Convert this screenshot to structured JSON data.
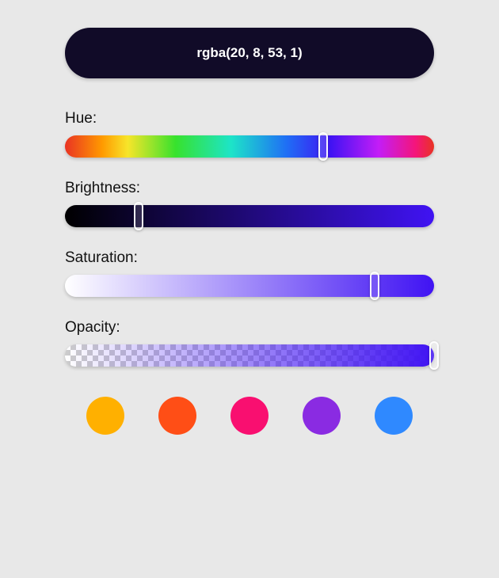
{
  "result": {
    "text": "rgba(20, 8, 53, 1)"
  },
  "sliders": {
    "hue": {
      "label": "Hue:",
      "value_pct": 70
    },
    "brightness": {
      "label": "Brightness:",
      "value_pct": 20
    },
    "saturation": {
      "label": "Saturation:",
      "value_pct": 84
    },
    "opacity": {
      "label": "Opacity:",
      "value_pct": 100
    }
  },
  "base_color": "#4013f3",
  "swatches": [
    {
      "name": "amber",
      "color": "#ffb000"
    },
    {
      "name": "orange",
      "color": "#ff4e16"
    },
    {
      "name": "pink",
      "color": "#f90f70"
    },
    {
      "name": "purple",
      "color": "#8a2be2"
    },
    {
      "name": "blue",
      "color": "#2f89ff"
    }
  ]
}
